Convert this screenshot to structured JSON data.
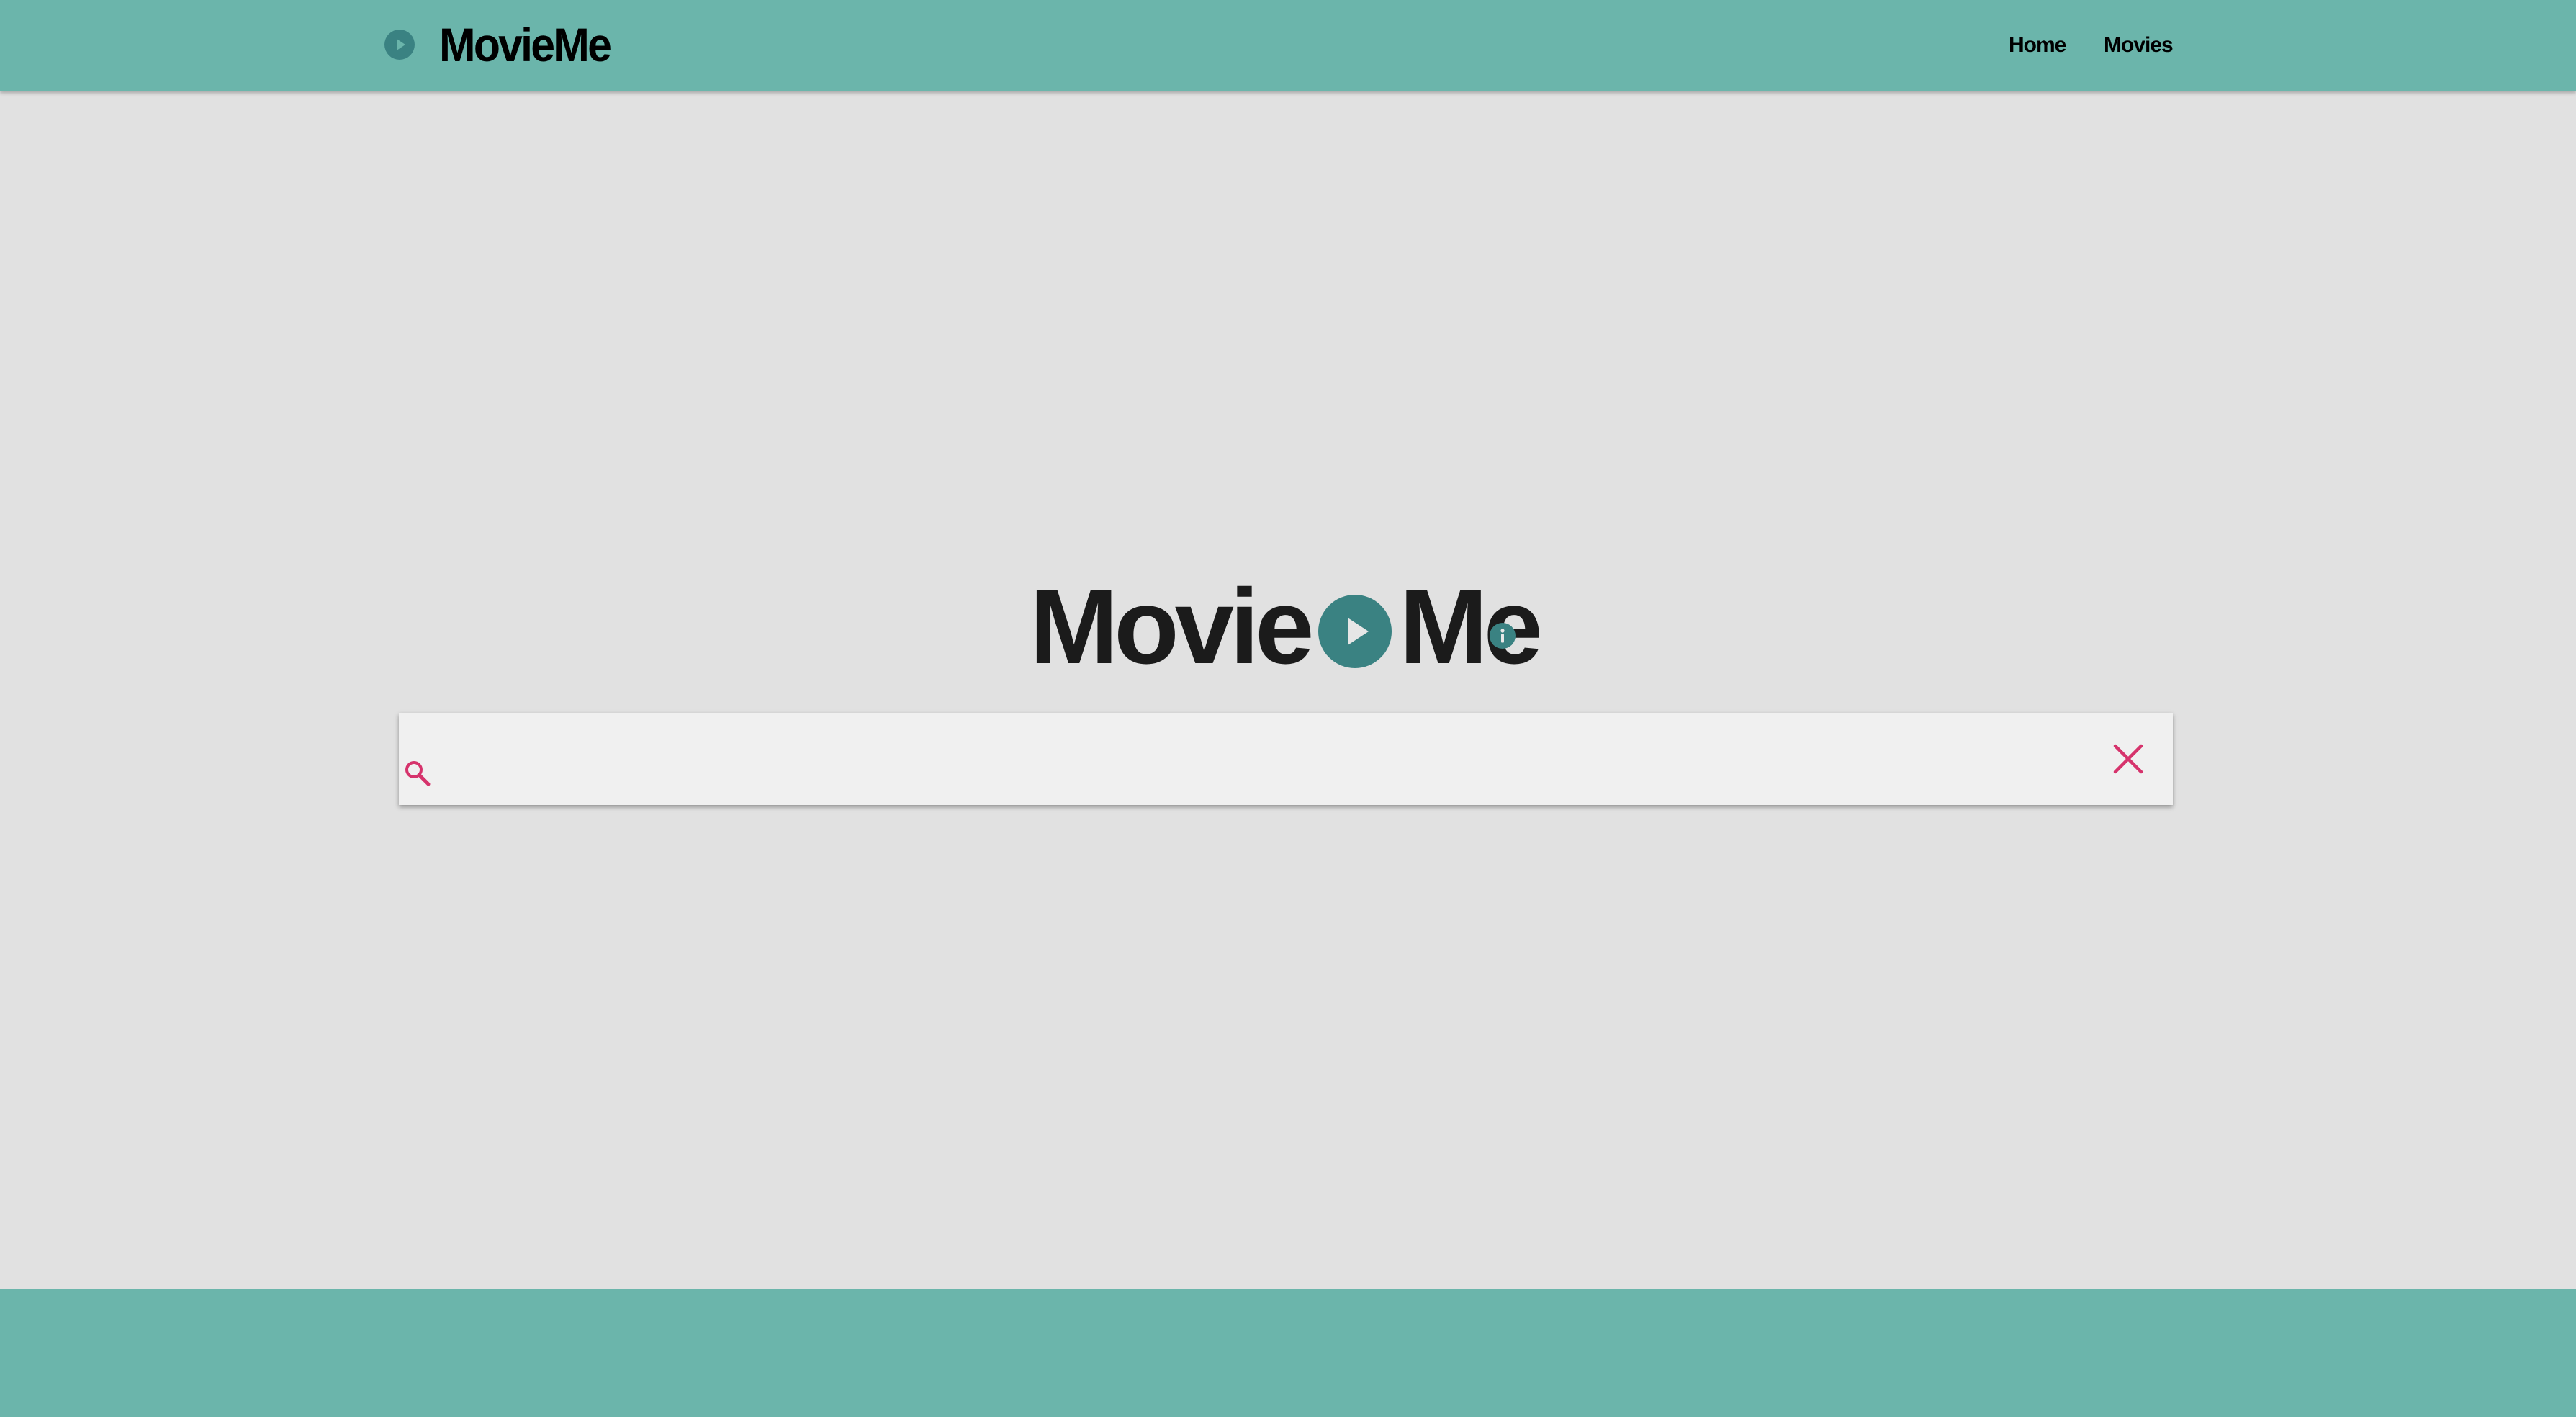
{
  "header": {
    "brand_name": "MovieMe",
    "brand_icon": "play-circle-icon",
    "nav": [
      {
        "label": "Home"
      },
      {
        "label": "Movies"
      }
    ]
  },
  "hero": {
    "word_left": "Movie",
    "word_right": "Me",
    "play_icon": "play-circle-icon",
    "info_icon": "info-icon"
  },
  "search": {
    "placeholder": "",
    "value": "",
    "search_icon": "search-icon",
    "clear_icon": "close-icon"
  },
  "colors": {
    "header_bg": "#6bb5ab",
    "page_bg": "#e1e1e1",
    "accent_teal": "#3a8282",
    "accent_pink": "#d6336c",
    "search_bg": "#f0f0f0"
  }
}
